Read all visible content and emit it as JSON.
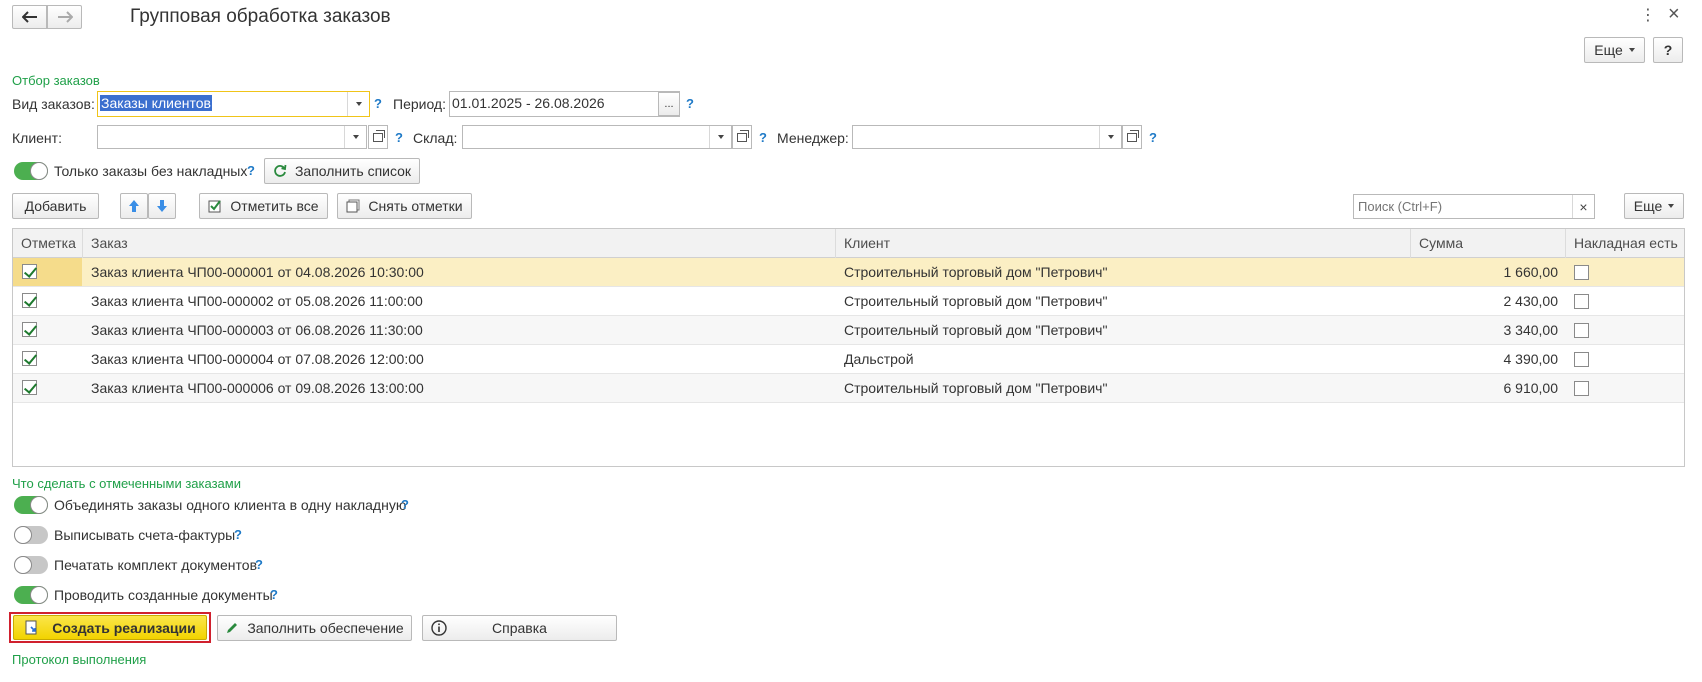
{
  "window": {
    "title": "Групповая обработка заказов",
    "more_label": "Еще",
    "help_label": "?",
    "menu_glyph": "⋮",
    "close_glyph": "×"
  },
  "filter": {
    "group_title": "Отбор заказов",
    "order_type_label": "Вид заказов:",
    "order_type_value": "Заказы клиентов",
    "period_label": "Период:",
    "period_value": "01.01.2025 - 26.08.2026",
    "period_btn": "...",
    "client_label": "Клиент:",
    "client_value": "",
    "warehouse_label": "Склад:",
    "warehouse_value": "",
    "manager_label": "Менеджер:",
    "manager_value": "",
    "only_without_invoices_label": "Только заказы без накладных",
    "only_without_invoices_on": true,
    "fill_list_label": "Заполнить список",
    "help": "?"
  },
  "toolbar": {
    "add_label": "Добавить",
    "check_all_label": "Отметить все",
    "uncheck_label": "Снять отметки",
    "search_placeholder": "Поиск (Ctrl+F)",
    "search_clear": "×",
    "more_label": "Еще"
  },
  "table": {
    "columns": [
      "Отметка",
      "Заказ",
      "Клиент",
      "Сумма",
      "Накладная есть"
    ],
    "rows": [
      {
        "checked": true,
        "order": "Заказ клиента ЧП00-000001 от 04.08.2026 10:30:00",
        "client": "Строительный торговый дом \"Петрович\"",
        "sum": "1 660,00",
        "invoice": false
      },
      {
        "checked": true,
        "order": "Заказ клиента ЧП00-000002 от 05.08.2026 11:00:00",
        "client": "Строительный торговый дом \"Петрович\"",
        "sum": "2 430,00",
        "invoice": false
      },
      {
        "checked": true,
        "order": "Заказ клиента ЧП00-000003 от 06.08.2026 11:30:00",
        "client": "Строительный торговый дом \"Петрович\"",
        "sum": "3 340,00",
        "invoice": false
      },
      {
        "checked": true,
        "order": "Заказ клиента ЧП00-000004 от 07.08.2026 12:00:00",
        "client": "Дальстрой",
        "sum": "4 390,00",
        "invoice": false
      },
      {
        "checked": true,
        "order": "Заказ клиента ЧП00-000006 от 09.08.2026 13:00:00",
        "client": "Строительный торговый дом \"Петрович\"",
        "sum": "6 910,00",
        "invoice": false
      }
    ]
  },
  "actions": {
    "group_title": "Что сделать с отмеченными заказами",
    "options": [
      {
        "label": "Объединять заказы одного клиента в одну накладную",
        "on": true
      },
      {
        "label": "Выписывать счета-фактуры",
        "on": false
      },
      {
        "label": "Печатать комплект документов",
        "on": false
      },
      {
        "label": "Проводить созданные документы",
        "on": true
      }
    ],
    "create_label": "Создать реализации",
    "fill_supply_label": "Заполнить обеспечение",
    "reference_label": "Справка",
    "help": "?"
  },
  "protocol": {
    "group_title": "Протокол выполнения"
  },
  "colors": {
    "accent_green": "#20a049",
    "toggle_on": "#4caf50",
    "selected_row": "#fbefc4",
    "primary_button": "#f9de1b",
    "highlight_border": "#d0202e",
    "help_blue": "#1f7ac7"
  }
}
